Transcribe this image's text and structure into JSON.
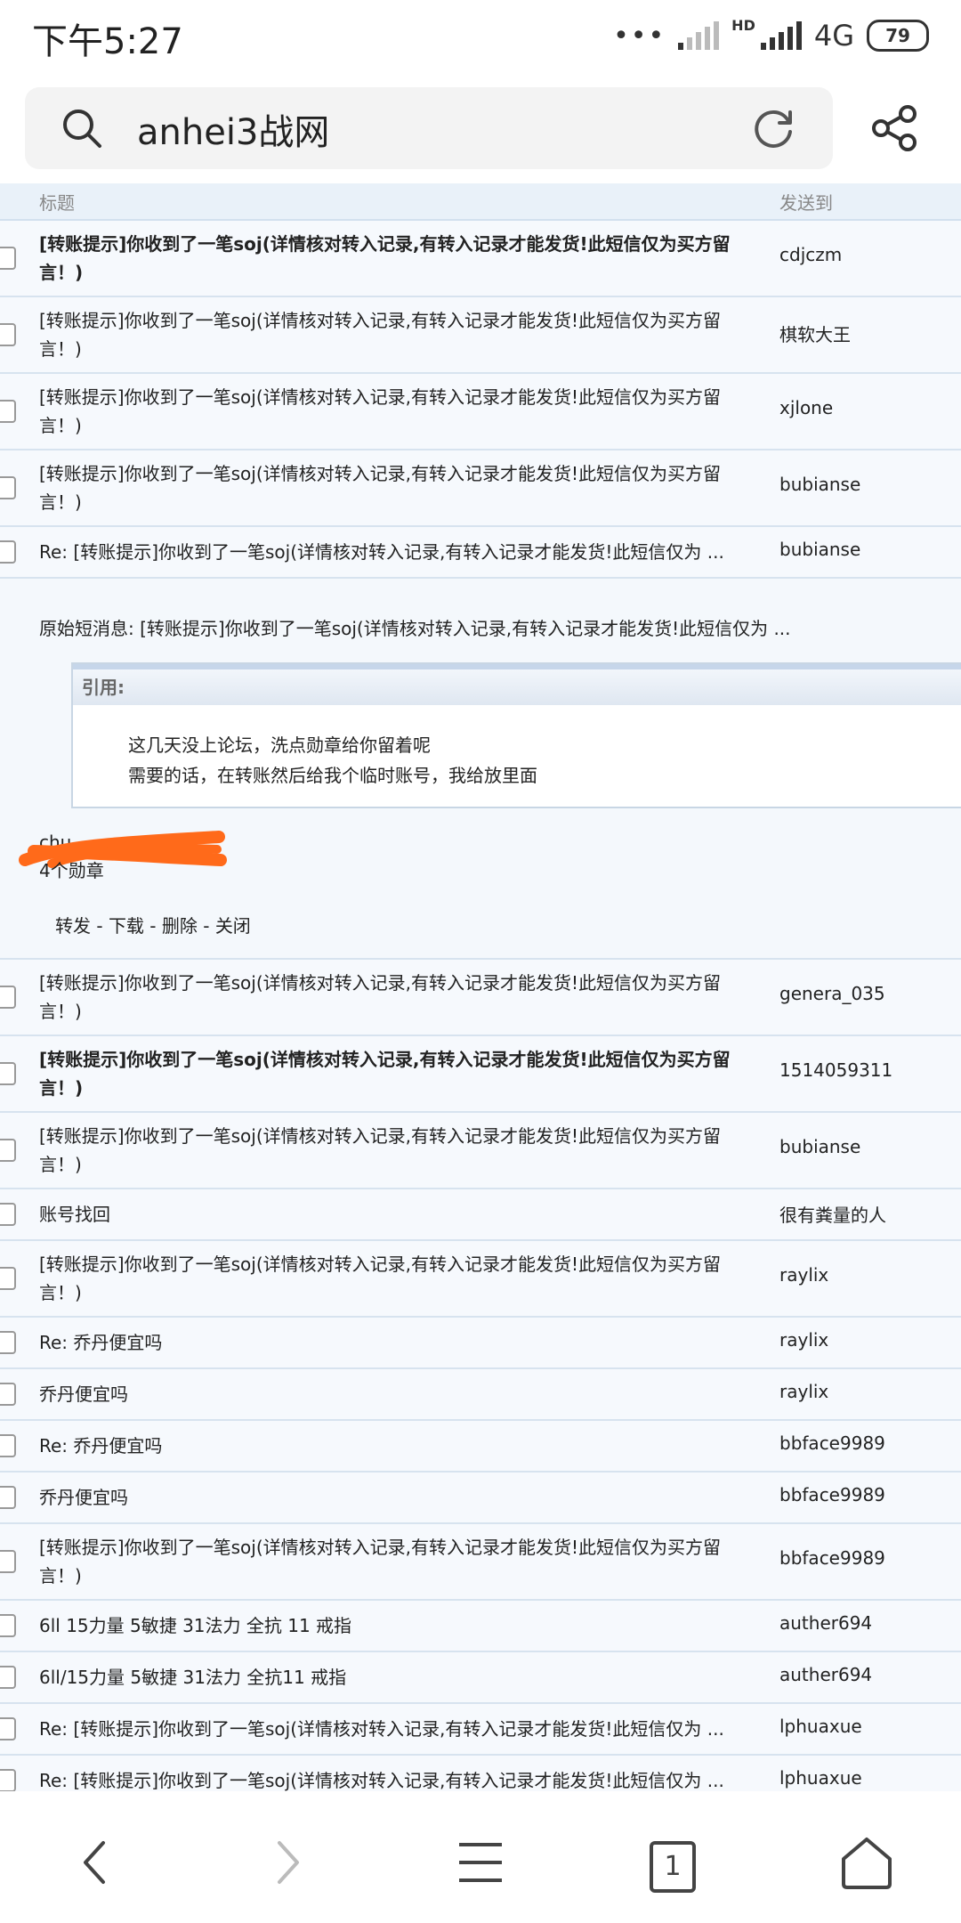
{
  "status": {
    "time": "下午5:27",
    "dots": "•••",
    "hd": "HD",
    "network": "4G",
    "battery": "79"
  },
  "search": {
    "query": "anhei3战网"
  },
  "table": {
    "col_title": "标题",
    "col_to": "发送到",
    "rows_before": [
      {
        "title": "[转账提示]你收到了一笔soj(详情核对转入记录,有转入记录才能发货!此短信仅为买方留言！)",
        "to": "cdjczm",
        "bold": true
      },
      {
        "title": "[转账提示]你收到了一笔soj(详情核对转入记录,有转入记录才能发货!此短信仅为买方留言！)",
        "to": "棋软大王",
        "bold": false
      },
      {
        "title": "[转账提示]你收到了一笔soj(详情核对转入记录,有转入记录才能发货!此短信仅为买方留言！)",
        "to": "xjlone",
        "bold": false
      },
      {
        "title": "[转账提示]你收到了一笔soj(详情核对转入记录,有转入记录才能发货!此短信仅为买方留言！)",
        "to": "bubianse",
        "bold": false
      },
      {
        "title": "Re: [转账提示]你收到了一笔soj(详情核对转入记录,有转入记录才能发货!此短信仅为 ...",
        "to": "bubianse",
        "bold": false
      }
    ],
    "rows_after": [
      {
        "title": "[转账提示]你收到了一笔soj(详情核对转入记录,有转入记录才能发货!此短信仅为买方留言！)",
        "to": "genera_035",
        "bold": false
      },
      {
        "title": "[转账提示]你收到了一笔soj(详情核对转入记录,有转入记录才能发货!此短信仅为买方留言！)",
        "to": "1514059311",
        "bold": true
      },
      {
        "title": "[转账提示]你收到了一笔soj(详情核对转入记录,有转入记录才能发货!此短信仅为买方留言！)",
        "to": "bubianse",
        "bold": false
      },
      {
        "title": "账号找回",
        "to": "很有粪量的人",
        "bold": false
      },
      {
        "title": "[转账提示]你收到了一笔soj(详情核对转入记录,有转入记录才能发货!此短信仅为买方留言！)",
        "to": "raylix",
        "bold": false
      },
      {
        "title": "Re: 乔丹便宜吗",
        "to": "raylix",
        "bold": false
      },
      {
        "title": "乔丹便宜吗",
        "to": "raylix",
        "bold": false
      },
      {
        "title": "Re: 乔丹便宜吗",
        "to": "bbface9989",
        "bold": false
      },
      {
        "title": "乔丹便宜吗",
        "to": "bbface9989",
        "bold": false
      },
      {
        "title": "[转账提示]你收到了一笔soj(详情核对转入记录,有转入记录才能发货!此短信仅为买方留言！)",
        "to": "bbface9989",
        "bold": false
      },
      {
        "title": "6ll 15力量 5敏捷 31法力 全抗 11 戒指",
        "to": "auther694",
        "bold": false
      },
      {
        "title": "6ll/15力量 5敏捷 31法力 全抗11 戒指",
        "to": "auther694",
        "bold": false
      },
      {
        "title": "Re: [转账提示]你收到了一笔soj(详情核对转入记录,有转入记录才能发货!此短信仅为 ...",
        "to": "lphuaxue",
        "bold": false
      },
      {
        "title": "Re: [转账提示]你收到了一笔soj(详情核对转入记录,有转入记录才能发货!此短信仅为 ...",
        "to": "lphuaxue",
        "bold": false
      }
    ]
  },
  "message": {
    "original": "原始短消息: [转账提示]你收到了一笔soj(详情核对转入记录,有转入记录才能发货!此短信仅为 ...",
    "quote_label": "引用:",
    "quote_line1": "这几天没上论坛，洗点勋章给你留着呢",
    "quote_line2": "需要的话，在转账然后给我个临时账号，我给放里面",
    "signature": "chu",
    "medals": "4个勋章",
    "action_forward": "转发",
    "action_download": "下载",
    "action_delete": "删除",
    "action_close": "关闭",
    "action_sep": " - "
  },
  "nav": {
    "tab_count": "1"
  },
  "colors": {
    "row_bg": "#f6f9fd",
    "row_border": "#d7e3ef",
    "header_bg": "#e9f1f9",
    "scribble": "#ff6a1a"
  },
  "icons": [
    "search-icon",
    "refresh-icon",
    "share-icon",
    "back-icon",
    "forward-icon",
    "menu-icon",
    "tabs-icon",
    "home-icon"
  ]
}
